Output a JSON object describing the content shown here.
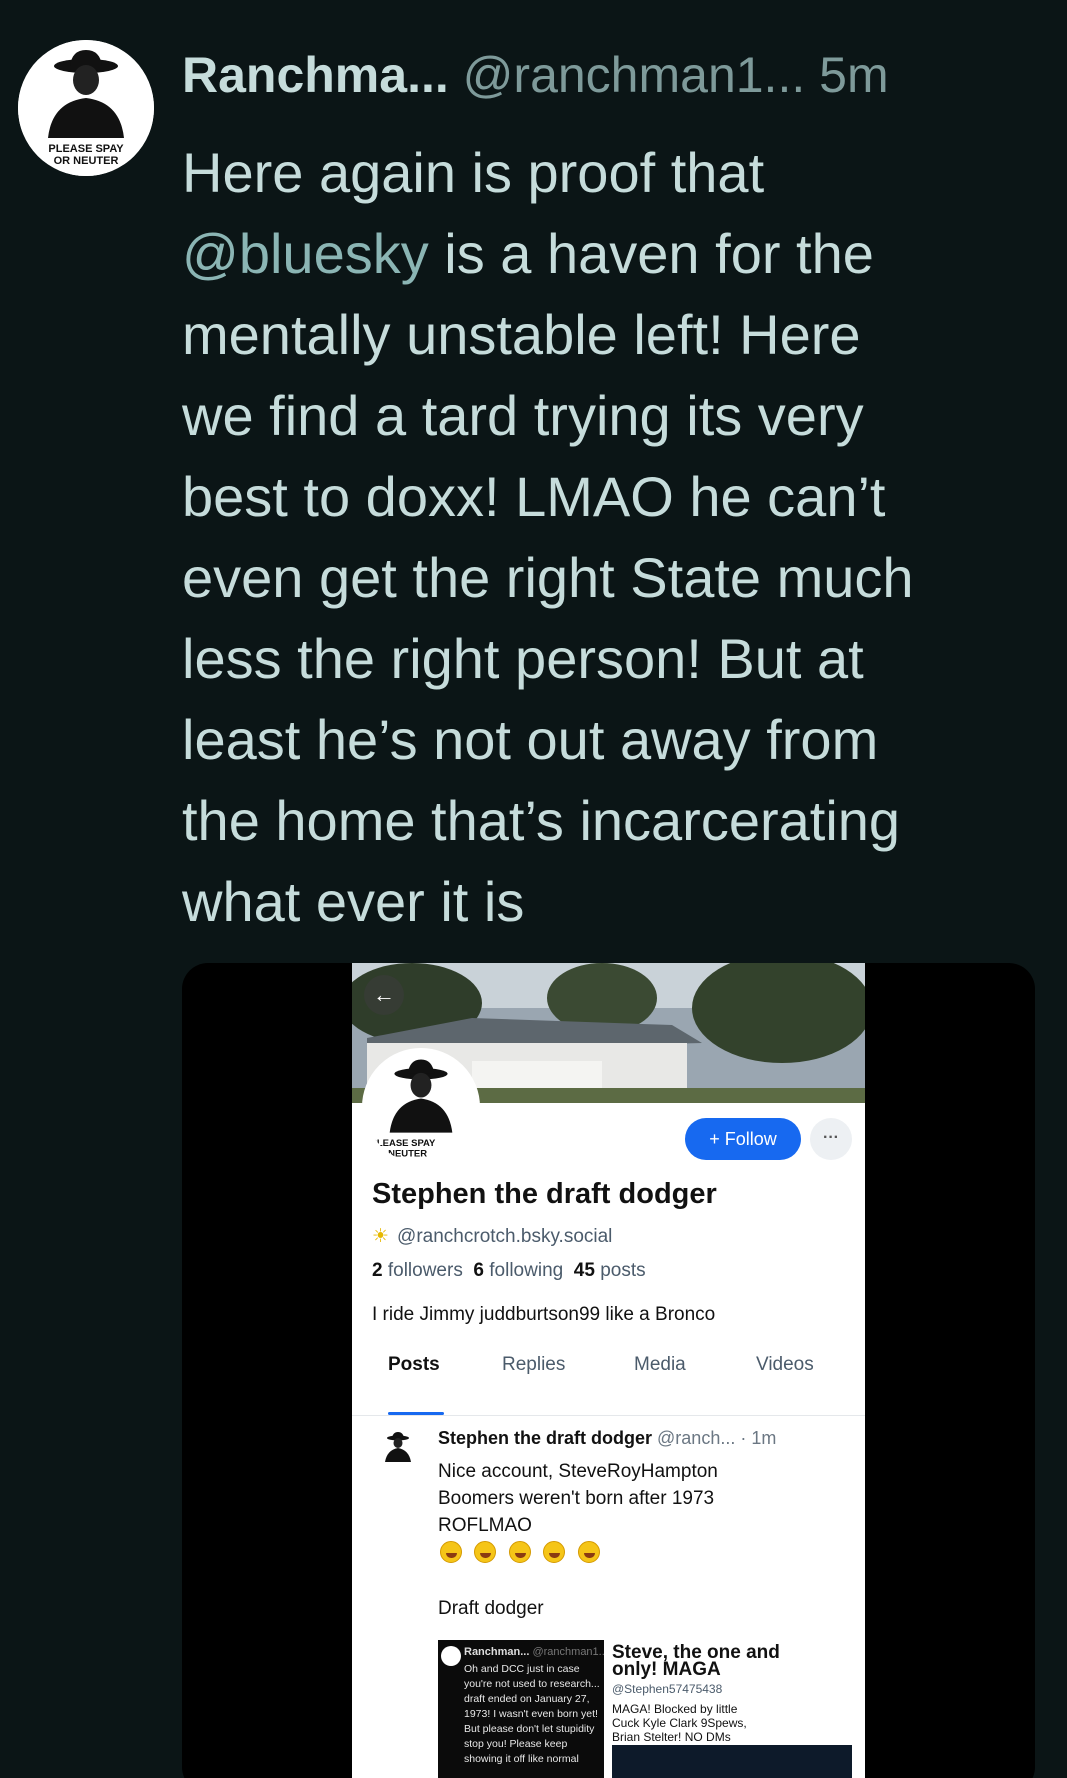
{
  "post": {
    "author_name": "Ranchma...",
    "author_handle": "@ranchman1...",
    "time": "5m",
    "text_before_mention": "Here again is proof that\n",
    "mention": "@bluesky",
    "text_after_mention": " is a haven for the\nmentally unstable left!  Here\nwe find a tard trying its very\nbest to doxx! LMAO he can’t\neven get the right State much\nless the right person!  But at\nleast he’s not out away from\nthe home that’s incarcerating\nwhat ever it is",
    "avatar_text": "PLEASE SPAY OR NEUTER YOUR DEMOCR"
  },
  "screenshot": {
    "back_icon": "←",
    "avatar_text": "PLEASE SPAY OR NEUTER",
    "follow_label": "+ Follow",
    "more_label": "···",
    "profile_name": "Stephen the draft dodger",
    "profile_handle": "@ranchcrotch.bsky.social",
    "followers_count": "2",
    "followers_label": "followers",
    "following_count": "6",
    "following_label": "following",
    "posts_count": "45",
    "posts_label": "posts",
    "bio": "I ride Jimmy juddburtson99 like a Bronco",
    "tabs": [
      "Posts",
      "Replies",
      "Media",
      "Videos"
    ],
    "active_tab": "Posts",
    "feed_post": {
      "author": "Stephen the draft dodger",
      "handle": "@ranch...",
      "time": "· 1m",
      "text": "Nice account, SteveRoyHampton\nBoomers weren't born after 1973\nROFLMAO",
      "emoji_count": 5,
      "text2": "Draft dodger"
    },
    "embed_left": {
      "name": "Ranchman...",
      "handle": "@ranchman1...",
      "text": "Oh and DCC just in case\nyou're not used to research...\ndraft ended on January 27,\n1973! I wasn't even born yet!\nBut please don't let stupidity\nstop you! Please keep\nshowing it off like normal"
    },
    "embed_right": {
      "title": "Steve, the one and\nonly! MAGA",
      "handle": "@Stephen57475438",
      "text": "MAGA! Blocked by little\nCuck Kyle Clark 9Spews,\nBrian Stelter! NO DMs"
    }
  },
  "colors": {
    "background": "#0b1516",
    "text": "#c6dcdb",
    "muted": "#7e9a9a",
    "follow_blue": "#1769f0"
  }
}
